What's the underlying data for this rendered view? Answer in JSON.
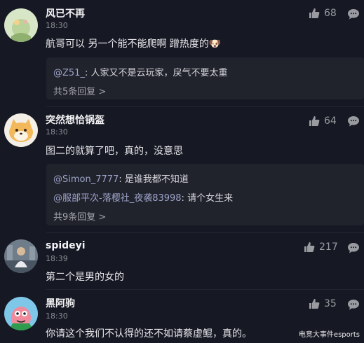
{
  "comments": [
    {
      "username": "风已不再",
      "time": "18:30",
      "text": "航哥可以 另一个能不能爬啊 蹭热度的🐶",
      "likes": "68",
      "replies": [
        {
          "at": "@Z51_",
          "sep": ": ",
          "text": "人家又不是云玩家，戾气不要太重"
        }
      ],
      "more": "共5条回复 >"
    },
    {
      "username": "突然想恰锅盔",
      "time": "18:30",
      "text": "图二的就算了吧，真的，没意思",
      "likes": "64",
      "replies": [
        {
          "at": "@Simon_7777",
          "sep": ": ",
          "text": "是谁我都不知道"
        },
        {
          "at": "@服部平次-落樱社_夜袭83998",
          "sep": ": ",
          "text": "请个女生来"
        }
      ],
      "more": "共9条回复 >"
    },
    {
      "username": "spideyi",
      "time": "18:39",
      "text": "第二个是男的女的",
      "likes": "217"
    },
    {
      "username": "黑阿驹",
      "time": "18:30",
      "text": "你请这个我们不认得的还不如请蔡虚鲲，真的。",
      "likes": "35"
    }
  ],
  "watermark": "电竞大事件esports",
  "colors": {
    "background": "#161823",
    "reply_box": "#20222c",
    "mention": "#9da3c7",
    "muted": "#8a8b91"
  },
  "icons": {
    "like": "thumbs-up-icon",
    "reply": "comment-bubble-icon"
  }
}
